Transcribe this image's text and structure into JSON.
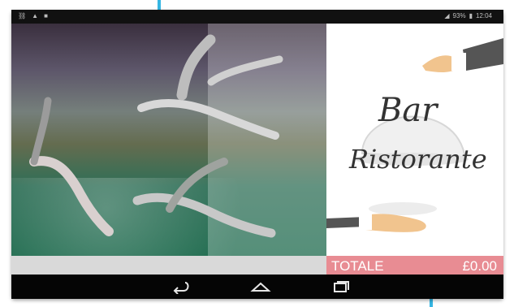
{
  "status_bar": {
    "battery": "93%",
    "time": "12:04",
    "icons": [
      "usb-icon",
      "warning-icon",
      "sd-card-icon",
      "signal-icon",
      "battery-icon"
    ]
  },
  "logo": {
    "line1": "Bar",
    "line2": "Ristorante"
  },
  "total": {
    "label": "TOTALE",
    "value": "£0.00"
  },
  "nav": [
    "back-icon",
    "home-icon",
    "recent-apps-icon"
  ],
  "colors": {
    "accent": "#e88c93",
    "callout": "#36b6e3"
  }
}
